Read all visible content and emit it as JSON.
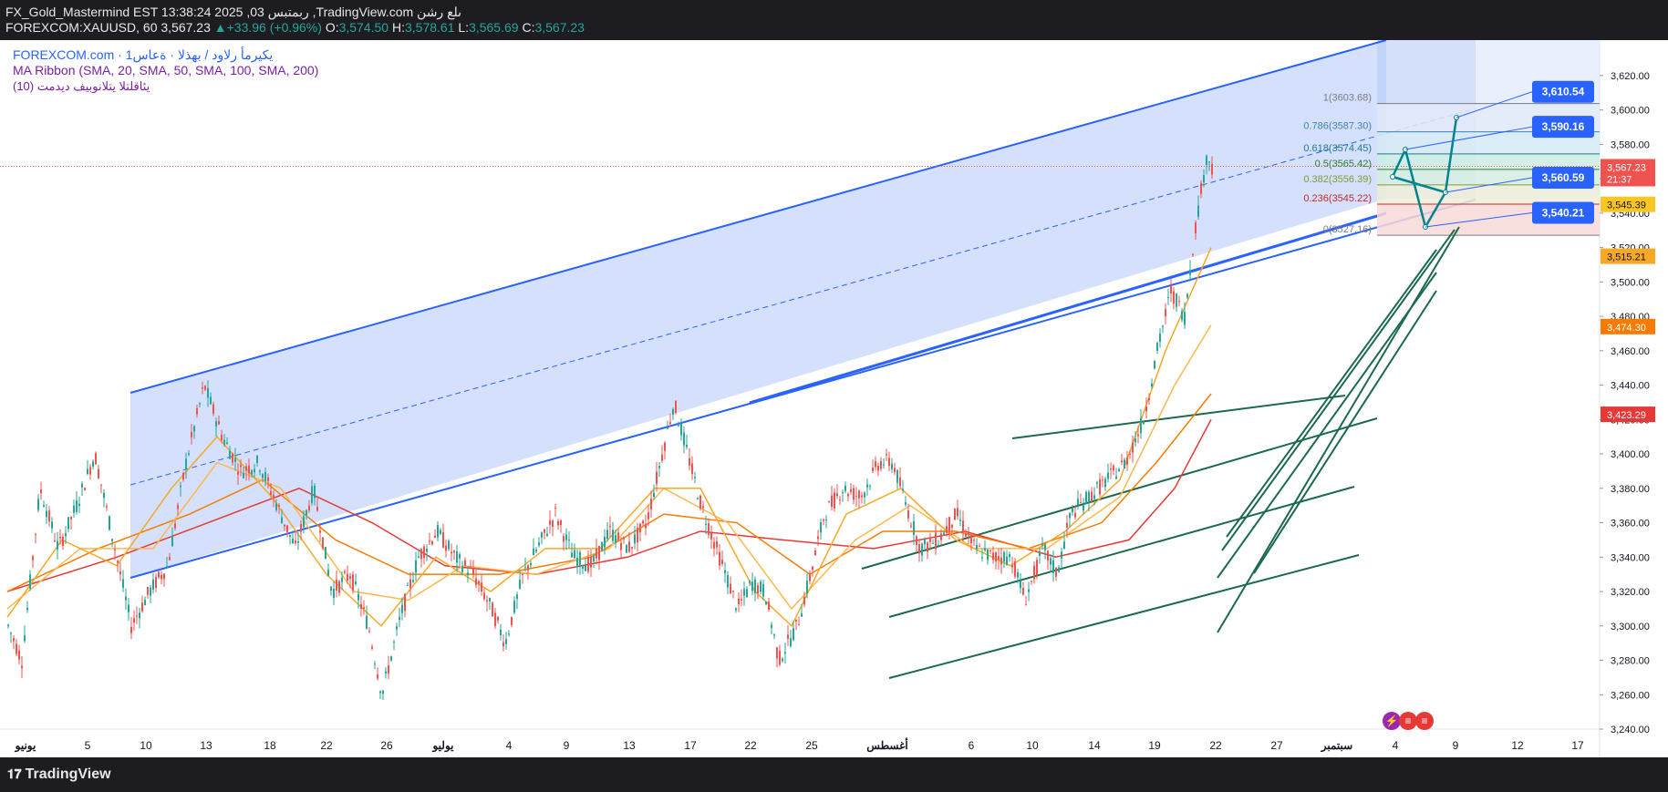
{
  "header": {
    "title_line": "FX_Gold_Mastermind EST 13:38:24 2025 ,03 ربمتبس ,TradingView.com ىلع رشن",
    "symbol": "FOREXCOM:XAUUSD, 60",
    "last": "3,567.23",
    "change": "+33.96 (+0.96%)",
    "o_label": "O:",
    "o": "3,574.50",
    "h_label": "H:",
    "h": "3,578.61",
    "l_label": "L:",
    "l": "3,565.69",
    "c_label": "C:",
    "c": "3,567.23"
  },
  "legend": {
    "symbol_line": "FOREXCOM.com · يكيرمأ رلاود / بهذلا · ةعاس1",
    "ma_ribbon": "MA Ribbon (SMA, 20, SMA, 50, SMA, 100, SMA, 200)",
    "indicator": "(10) يئاقلتلا يتلانوبيف ديدمت"
  },
  "footer": {
    "brand": "TradingView"
  },
  "colors": {
    "bull": "#26a69a",
    "bear": "#ef5350",
    "channel": "#2962ff",
    "channel_fill": "#c7d6fb",
    "green_lines": "#1b6b4b",
    "sma20": "#f9a825",
    "sma50": "#ffb74d",
    "sma100": "#f57c00",
    "sma200": "#e53935",
    "projection": "#00838f"
  },
  "chart_data": {
    "type": "candlestick",
    "ylim": [
      3240,
      3630
    ],
    "yticks": [
      "3,240.00",
      "3,260.00",
      "3,280.00",
      "3,300.00",
      "3,320.00",
      "3,340.00",
      "3,360.00",
      "3,380.00",
      "3,400.00",
      "3,420.00",
      "3,440.00",
      "3,460.00",
      "3,480.00",
      "3,500.00",
      "3,520.00",
      "3,540.00",
      "3,560.00",
      "3,580.00",
      "3,600.00",
      "3,620.00"
    ],
    "xticks": [
      "يونيو",
      "5",
      "10",
      "13",
      "18",
      "22",
      "26",
      "يوليو",
      "4",
      "9",
      "13",
      "17",
      "22",
      "25",
      "أغسطس",
      "6",
      "10",
      "14",
      "19",
      "22",
      "27",
      "سبتمبر",
      "4",
      "9",
      "12",
      "17"
    ],
    "fib_levels": [
      {
        "label": "1(3603.68)",
        "value": 3603.68
      },
      {
        "label": "0.786(3587.30)",
        "value": 3587.3
      },
      {
        "label": "0.618(3574.45)",
        "value": 3574.45
      },
      {
        "label": "0.5(3565.42)",
        "value": 3565.42
      },
      {
        "label": "0.382(3556.39)",
        "value": 3556.39
      },
      {
        "label": "0.236(3545.22)",
        "value": 3545.22
      },
      {
        "label": "0(3527.16)",
        "value": 3527.16
      }
    ],
    "target_labels": [
      {
        "text": "3,610.54",
        "value": 3610.54
      },
      {
        "text": "3,590.16",
        "value": 3590.16
      },
      {
        "text": "3,560.59",
        "value": 3560.59
      },
      {
        "text": "3,540.21",
        "value": 3540.21
      }
    ],
    "price_labels": [
      {
        "text": "3,567.23",
        "sub": "21:37",
        "value": 3567.23,
        "color": "#ef5350"
      },
      {
        "text": "3,545.39",
        "value": 3545.39,
        "color": "#f9c623"
      },
      {
        "text": "3,515.21",
        "value": 3515.21,
        "color": "#f9a825"
      },
      {
        "text": "3,474.30",
        "value": 3474.3,
        "color": "#f57c00"
      },
      {
        "text": "3,423.29",
        "value": 3423.29,
        "color": "#e53935"
      }
    ],
    "current_price": 3567.23,
    "price_path": [
      [
        0,
        3300
      ],
      [
        15,
        3280
      ],
      [
        35,
        3380
      ],
      [
        55,
        3345
      ],
      [
        75,
        3370
      ],
      [
        95,
        3400
      ],
      [
        115,
        3350
      ],
      [
        135,
        3300
      ],
      [
        155,
        3320
      ],
      [
        175,
        3335
      ],
      [
        195,
        3395
      ],
      [
        215,
        3440
      ],
      [
        235,
        3410
      ],
      [
        255,
        3390
      ],
      [
        275,
        3395
      ],
      [
        295,
        3370
      ],
      [
        315,
        3345
      ],
      [
        335,
        3380
      ],
      [
        355,
        3320
      ],
      [
        375,
        3330
      ],
      [
        395,
        3300
      ],
      [
        410,
        3260
      ],
      [
        430,
        3305
      ],
      [
        450,
        3340
      ],
      [
        470,
        3355
      ],
      [
        490,
        3340
      ],
      [
        510,
        3330
      ],
      [
        530,
        3310
      ],
      [
        545,
        3290
      ],
      [
        565,
        3330
      ],
      [
        585,
        3350
      ],
      [
        600,
        3365
      ],
      [
        620,
        3340
      ],
      [
        640,
        3335
      ],
      [
        660,
        3355
      ],
      [
        680,
        3345
      ],
      [
        700,
        3360
      ],
      [
        715,
        3395
      ],
      [
        730,
        3430
      ],
      [
        745,
        3400
      ],
      [
        760,
        3370
      ],
      [
        780,
        3340
      ],
      [
        800,
        3310
      ],
      [
        815,
        3325
      ],
      [
        830,
        3320
      ],
      [
        845,
        3280
      ],
      [
        865,
        3300
      ],
      [
        880,
        3330
      ],
      [
        895,
        3365
      ],
      [
        915,
        3380
      ],
      [
        935,
        3375
      ],
      [
        955,
        3395
      ],
      [
        970,
        3395
      ],
      [
        985,
        3370
      ],
      [
        1000,
        3345
      ],
      [
        1020,
        3350
      ],
      [
        1040,
        3365
      ],
      [
        1060,
        3345
      ],
      [
        1080,
        3340
      ],
      [
        1100,
        3340
      ],
      [
        1115,
        3315
      ],
      [
        1135,
        3345
      ],
      [
        1150,
        3330
      ],
      [
        1165,
        3365
      ],
      [
        1185,
        3375
      ],
      [
        1205,
        3385
      ],
      [
        1225,
        3395
      ],
      [
        1245,
        3420
      ],
      [
        1260,
        3460
      ],
      [
        1275,
        3495
      ],
      [
        1290,
        3480
      ],
      [
        1300,
        3525
      ],
      [
        1310,
        3560
      ],
      [
        1315,
        3574
      ],
      [
        1320,
        3567
      ]
    ],
    "sma20_path": [
      [
        0,
        3305
      ],
      [
        60,
        3350
      ],
      [
        120,
        3335
      ],
      [
        180,
        3380
      ],
      [
        230,
        3410
      ],
      [
        290,
        3375
      ],
      [
        350,
        3330
      ],
      [
        410,
        3300
      ],
      [
        470,
        3340
      ],
      [
        530,
        3320
      ],
      [
        590,
        3345
      ],
      [
        650,
        3345
      ],
      [
        710,
        3380
      ],
      [
        760,
        3380
      ],
      [
        820,
        3320
      ],
      [
        860,
        3300
      ],
      [
        920,
        3365
      ],
      [
        980,
        3380
      ],
      [
        1040,
        3350
      ],
      [
        1100,
        3335
      ],
      [
        1160,
        3355
      ],
      [
        1220,
        3385
      ],
      [
        1270,
        3460
      ],
      [
        1320,
        3520
      ]
    ],
    "sma50_path": [
      [
        0,
        3310
      ],
      [
        80,
        3345
      ],
      [
        160,
        3345
      ],
      [
        230,
        3395
      ],
      [
        300,
        3380
      ],
      [
        380,
        3320
      ],
      [
        440,
        3315
      ],
      [
        500,
        3335
      ],
      [
        580,
        3330
      ],
      [
        660,
        3345
      ],
      [
        720,
        3380
      ],
      [
        790,
        3360
      ],
      [
        860,
        3310
      ],
      [
        930,
        3350
      ],
      [
        990,
        3370
      ],
      [
        1060,
        3345
      ],
      [
        1140,
        3345
      ],
      [
        1220,
        3375
      ],
      [
        1280,
        3440
      ],
      [
        1320,
        3475
      ]
    ],
    "sma100_path": [
      [
        0,
        3320
      ],
      [
        100,
        3345
      ],
      [
        200,
        3365
      ],
      [
        280,
        3385
      ],
      [
        360,
        3350
      ],
      [
        440,
        3330
      ],
      [
        540,
        3330
      ],
      [
        640,
        3340
      ],
      [
        720,
        3365
      ],
      [
        800,
        3360
      ],
      [
        880,
        3330
      ],
      [
        960,
        3355
      ],
      [
        1040,
        3355
      ],
      [
        1120,
        3345
      ],
      [
        1200,
        3360
      ],
      [
        1260,
        3395
      ],
      [
        1320,
        3435
      ]
    ],
    "sma200_path": [
      [
        0,
        3320
      ],
      [
        120,
        3340
      ],
      [
        220,
        3360
      ],
      [
        320,
        3380
      ],
      [
        400,
        3360
      ],
      [
        480,
        3335
      ],
      [
        580,
        3330
      ],
      [
        680,
        3340
      ],
      [
        760,
        3355
      ],
      [
        850,
        3350
      ],
      [
        950,
        3345
      ],
      [
        1050,
        3355
      ],
      [
        1150,
        3340
      ],
      [
        1230,
        3350
      ],
      [
        1280,
        3380
      ],
      [
        1320,
        3420
      ]
    ]
  }
}
